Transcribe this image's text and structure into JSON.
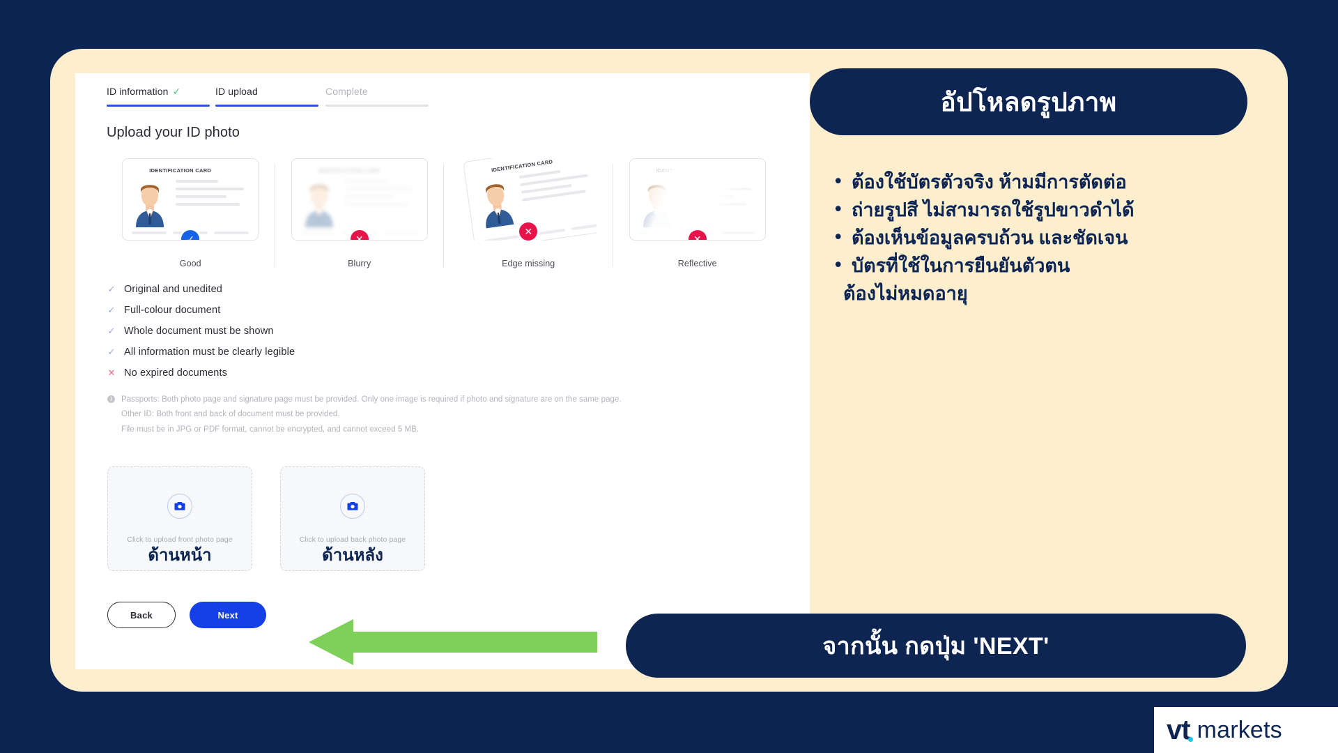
{
  "stepper": {
    "steps": [
      {
        "label": "ID information",
        "check": "✓",
        "state": "done"
      },
      {
        "label": "ID upload",
        "check": "",
        "state": "active"
      },
      {
        "label": "Complete",
        "check": "",
        "state": "upcoming"
      }
    ]
  },
  "main": {
    "heading": "Upload your ID photo",
    "card_title": "IDENTIFICATION CARD",
    "examples": [
      {
        "caption": "Good",
        "badge": "✓",
        "badge_type": "ok"
      },
      {
        "caption": "Blurry",
        "badge": "✕",
        "badge_type": "bad"
      },
      {
        "caption": "Edge missing",
        "badge": "✕",
        "badge_type": "bad"
      },
      {
        "caption": "Reflective",
        "badge": "✕",
        "badge_type": "bad"
      }
    ],
    "checklist": [
      {
        "mark": "✓",
        "type": "check",
        "text": "Original and unedited"
      },
      {
        "mark": "✓",
        "type": "check",
        "text": "Full-colour document"
      },
      {
        "mark": "✓",
        "type": "check",
        "text": "Whole document must be shown"
      },
      {
        "mark": "✓",
        "type": "check",
        "text": "All information must be clearly legible"
      },
      {
        "mark": "✕",
        "type": "cross",
        "text": "No expired documents"
      }
    ],
    "footnote": {
      "line1": "Passports: Both photo page and signature page must be provided. Only one image is required if photo and signature are on the same page.",
      "line2": "Other ID: Both front and back of document must be provided.",
      "line3": "File must be in JPG or PDF format, cannot be encrypted, and cannot exceed 5 MB."
    },
    "dropzones": [
      {
        "text": "Click to upload front photo page",
        "thai": "ด้านหน้า",
        "icon": "camera-icon"
      },
      {
        "text": "Click to upload back photo page",
        "thai": "ด้านหลัง",
        "icon": "camera-icon"
      }
    ],
    "buttons": {
      "back": "Back",
      "next": "Next"
    }
  },
  "annotations": {
    "title": "อัปโหลดรูปภาพ",
    "bullets": [
      {
        "text": "ต้องใช้บัตรตัวจริง ห้ามมีการตัดต่อ",
        "continuation": ""
      },
      {
        "text": "ถ่ายรูปสี ไม่สามารถใช้รูปขาวดำได้",
        "continuation": ""
      },
      {
        "text": "ต้องเห็นข้อมูลครบถ้วน และชัดเจน",
        "continuation": ""
      },
      {
        "text": "บัตรที่ใช้ในการยืนยันตัวตน",
        "continuation": "ต้องไม่หมดอายุ"
      }
    ],
    "footer": "จากนั้น กดปุ่ม 'NEXT'",
    "arrow": "left-arrow-icon"
  },
  "brand": {
    "mark": "vt",
    "word": "markets"
  },
  "colors": {
    "background": "#0c2452",
    "cream": "#fdeecd",
    "navy": "#0f2551",
    "accent_blue": "#1540e8",
    "badge_ok": "#1763e8",
    "badge_bad": "#e8134a",
    "arrow_green": "#7ed058",
    "logo_dot": "#19c6e6"
  }
}
